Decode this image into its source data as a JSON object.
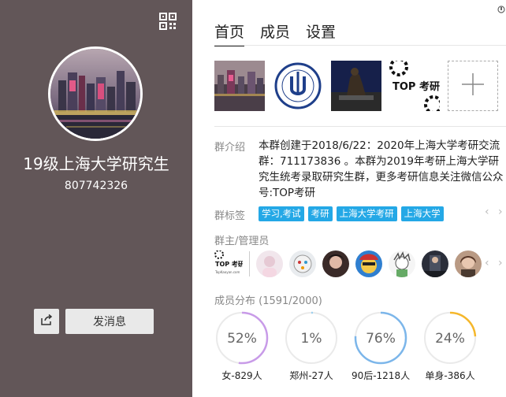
{
  "group": {
    "name": "19级上海大学研究生",
    "id": "807742326"
  },
  "buttons": {
    "send_message": "发消息"
  },
  "tabs": [
    "首页",
    "成员",
    "设置"
  ],
  "photos": {
    "photo4_caption": "TOP 考研",
    "add_icon": "plus-icon"
  },
  "intro": {
    "label": "群介绍",
    "text": "本群创建于2018/6/22：2020年上海大学考研交流群：711173836 。本群为2019年考研上海大学研究生统考录取研究生群，更多考研信息关注微信公众号:TOP考研"
  },
  "tags": {
    "label": "群标签",
    "items": [
      "学习,考试",
      "考研",
      "上海大学考研",
      "上海大学"
    ],
    "prev": "‹",
    "next": "›"
  },
  "admins": {
    "label": "群主/管理员",
    "owner_logo": "TOP 考研",
    "owner_caption": "TopKaoyan.com"
  },
  "distribution": {
    "label": "成员分布",
    "count": "(1591/2000)",
    "items": [
      {
        "pct": "52%",
        "value": 0.52,
        "color": "#c89be8",
        "label": "女-829人"
      },
      {
        "pct": "1%",
        "value": 0.01,
        "color": "#9bd0f0",
        "label": "郑州-27人"
      },
      {
        "pct": "76%",
        "value": 0.76,
        "color": "#7cb6ea",
        "label": "90后-1218人"
      },
      {
        "pct": "24%",
        "value": 0.24,
        "color": "#f5b72b",
        "label": "单身-386人"
      }
    ]
  },
  "icons": {
    "qr": "qr-code-icon",
    "share": "share-icon",
    "corner": "corner-icon"
  }
}
